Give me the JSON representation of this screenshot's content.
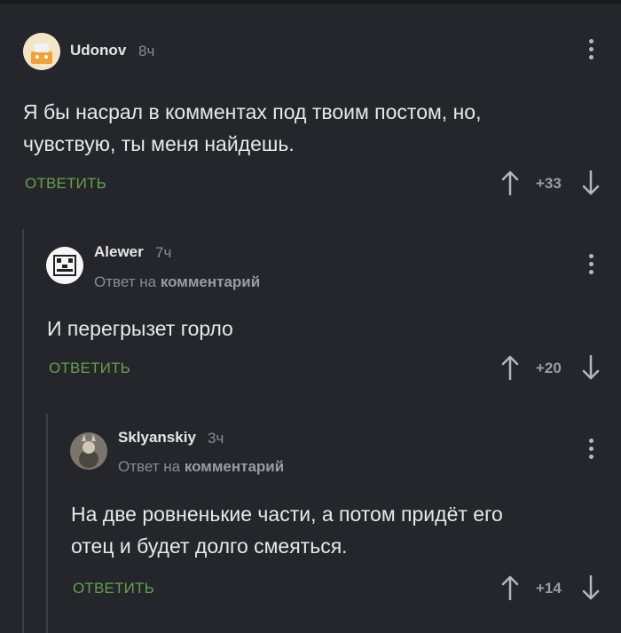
{
  "comments": [
    {
      "username": "Udonov",
      "time": "8ч",
      "reply_to_prefix": "",
      "reply_to_target": "",
      "text_lines": [
        "Я бы насрал в комментах под твоим постом, но,",
        "чувствую, ты меня найдешь."
      ],
      "reply_label": "ОТВЕТИТЬ",
      "score": "+33"
    },
    {
      "username": "Alewer",
      "time": "7ч",
      "reply_to_prefix": "Ответ на",
      "reply_to_target": "комментарий",
      "text_lines": [
        "И перегрызет горло"
      ],
      "reply_label": "ОТВЕТИТЬ",
      "score": "+20"
    },
    {
      "username": "Sklyanskiy",
      "time": "3ч",
      "reply_to_prefix": "Ответ на",
      "reply_to_target": "комментарий",
      "text_lines": [
        "На две ровненькие части, а потом придёт его",
        "отец и будет долго смеяться."
      ],
      "reply_label": "ОТВЕТИТЬ",
      "score": "+14"
    }
  ],
  "colors": {
    "background": "#24262b",
    "accent_green": "#65a14c",
    "text": "#e8e8e8",
    "muted": "#8a8c92"
  }
}
